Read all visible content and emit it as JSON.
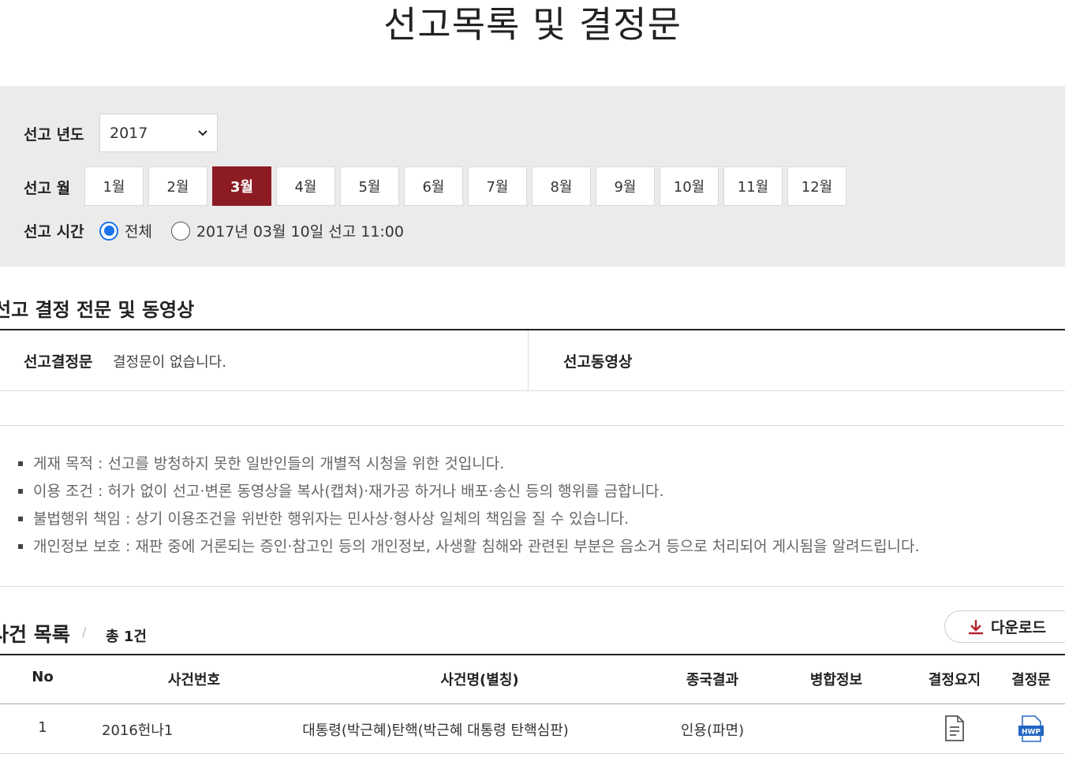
{
  "page": {
    "title": "선고목록 및 결정문"
  },
  "filter": {
    "year_label": "선고 년도",
    "year_value": "2017",
    "month_label": "선고 월",
    "months": [
      "1월",
      "2월",
      "3월",
      "4월",
      "5월",
      "6월",
      "7월",
      "8월",
      "9월",
      "10월",
      "11월",
      "12월"
    ],
    "selected_month": "3월",
    "time_label": "선고 시간",
    "time_options": [
      "전체",
      "2017년 03월 10일 선고 11:00"
    ],
    "selected_time": "전체"
  },
  "decision": {
    "heading": "선고 결정 전문 및 동영상",
    "doc_label": "선고결정문",
    "doc_value": "결정문이 없습니다.",
    "video_label": "선고동영상"
  },
  "notices": [
    "게재 목적 : 선고를 방청하지 못한 일반인들의 개별적 시청을 위한 것입니다.",
    "이용 조건 : 허가 없이 선고·변론 동영상을 복사(캡쳐)·재가공 하거나 배포·송신 등의 행위를 금합니다.",
    "불법행위 책임 : 상기 이용조건을 위반한 행위자는 민사상·형사상 일체의 책임을 질 수 있습니다.",
    "개인정보 보호 : 재판 중에 거론되는 증인·참고인 등의 개인정보, 사생활 침해와 관련된 부분은 음소거 등으로 처리되어 게시됨을 알려드립니다."
  ],
  "cases": {
    "heading": "사건 목록",
    "count_text": "총 1건",
    "download_label": "다운로드",
    "columns": [
      "No",
      "사건번호",
      "사건명(별칭)",
      "종국결과",
      "병합정보",
      "결정요지",
      "결정문"
    ],
    "rows": [
      {
        "no": "1",
        "case_no": "2016헌나1",
        "case_name": "대통령(박근혜)탄핵(박근혜 대통령 탄핵심판)",
        "result": "인용(파면)",
        "merge": ""
      }
    ]
  },
  "icons": {
    "download": "download-icon",
    "summary": "document-icon",
    "decision": "hwp-file-icon"
  },
  "colors": {
    "accent": "#8d1b24",
    "radio": "#1a73e8",
    "filter_bg": "#ebebeb"
  }
}
